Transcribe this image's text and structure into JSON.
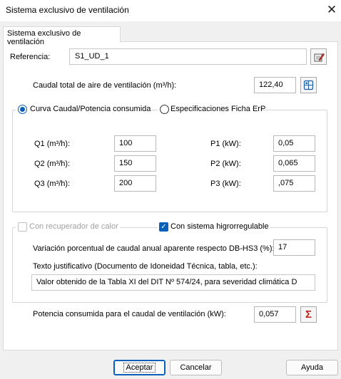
{
  "window": {
    "title": "Sistema exclusivo de ventilación",
    "close_glyph": "✕"
  },
  "tab": {
    "label": "Sistema exclusivo de ventilación"
  },
  "referencia": {
    "label": "Referencia:",
    "value": "S1_UD_1",
    "icon": "edit-reference-icon"
  },
  "caudal_total": {
    "label": "Caudal total de aire de ventilación (m³/h):",
    "value": "122,40",
    "icon": "calculator-icon"
  },
  "curva": {
    "option1_label": "Curva Caudal/Potencia consumida",
    "option1_selected": true,
    "option2_label": "Especificaciones Ficha ErP",
    "option2_selected": false,
    "q1_label": "Q1 (m³/h):",
    "q1_value": "100",
    "q2_label": "Q2 (m³/h):",
    "q2_value": "150",
    "q3_label": "Q3 (m³/h):",
    "q3_value": "200",
    "p1_label": "P1 (kW):",
    "p1_value": "0,05",
    "p2_label": "P2 (kW):",
    "p2_value": "0,065",
    "p3_label": "P3 (kW):",
    "p3_value": ",075"
  },
  "recuperador": {
    "label": "Con recuperador de calor",
    "checked": false,
    "enabled": false
  },
  "higro": {
    "label": "Con sistema higrorregulable",
    "checked": true,
    "variacion_label": "Variación porcentual de caudal anual aparente respecto DB-HS3 (%):",
    "variacion_value": "17",
    "texto_label": "Texto justificativo (Documento de Idoneidad Técnica, tabla, etc.):",
    "texto_value": "Valor obtenido de la Tabla XI del DIT Nº 574/24, para severidad climática D"
  },
  "potencia": {
    "label": "Potencia consumida para el caudal de ventilación (kW):",
    "value": "0,057",
    "icon": "sigma-icon",
    "icon_glyph": "Σ"
  },
  "buttons": {
    "accept": "Aceptar",
    "cancel": "Cancelar",
    "help": "Ayuda"
  },
  "colors": {
    "accent": "#0a5fb8",
    "sigma_red": "#c0201a"
  }
}
